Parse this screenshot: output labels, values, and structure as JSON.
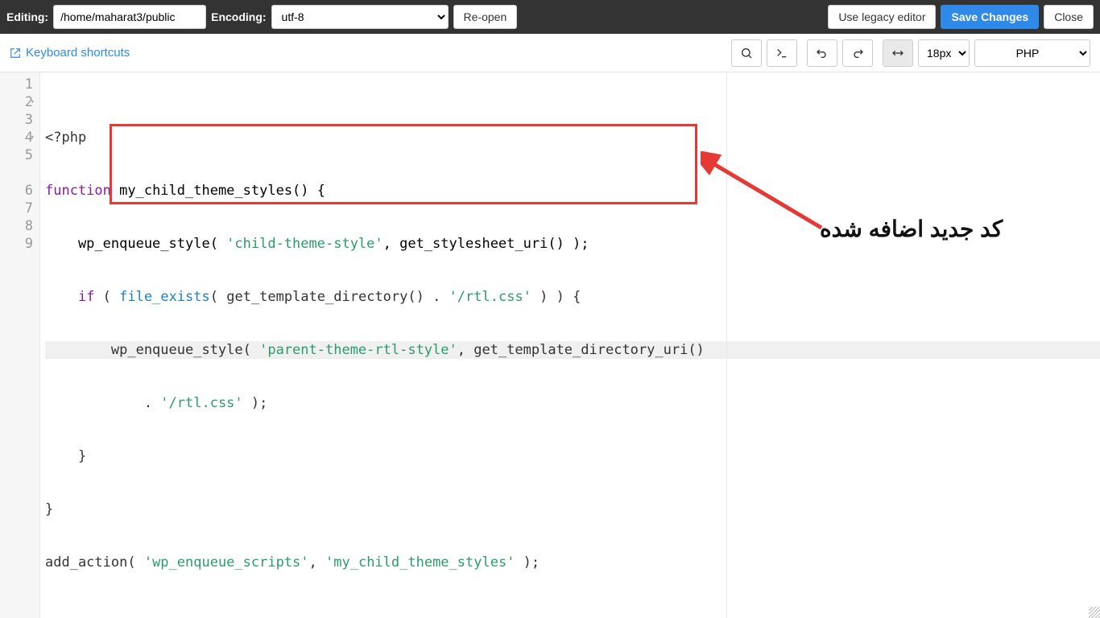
{
  "topbar": {
    "editing_label": "Editing:",
    "file_path": "/home/maharat3/public",
    "encoding_label": "Encoding:",
    "encoding_value": "utf-8",
    "reopen": "Re-open",
    "legacy": "Use legacy editor",
    "save": "Save Changes",
    "close": "Close"
  },
  "toolbar": {
    "keyboard_shortcuts": "Keyboard shortcuts",
    "font_size": "18px",
    "language": "PHP"
  },
  "gutter": {
    "lines": [
      "1",
      "2",
      "3",
      "4",
      "5",
      "6",
      "7",
      "8",
      "9"
    ],
    "folds": [
      1,
      3
    ]
  },
  "code": {
    "l1": {
      "a": "<?php"
    },
    "l2": {
      "a": "function",
      "b": " my_child_theme_styles() {"
    },
    "l3": {
      "a": "    wp_enqueue_style( ",
      "b": "'child-theme-style'",
      "c": ", get_stylesheet_uri() );"
    },
    "l4": {
      "a": "    ",
      "b": "if",
      "c": " ( ",
      "d": "file_exists",
      "e": "( get_template_directory() . ",
      "f": "'/rtl.css'",
      "g": " ) ) {"
    },
    "l5": {
      "a": "        wp_enqueue_style( ",
      "b": "'parent-theme-rtl-style'",
      "c": ", get_template_directory_uri()"
    },
    "l5b": {
      "a": "            . ",
      "b": "'/rtl.css'",
      "c": " );"
    },
    "l6": {
      "a": "    }"
    },
    "l7": {
      "a": "}"
    },
    "l8": {
      "a": "add_action( ",
      "b": "'wp_enqueue_scripts'",
      "c": ", ",
      "d": "'my_child_theme_styles'",
      "e": " );"
    }
  },
  "annotation": "کد جدید اضافه شده"
}
